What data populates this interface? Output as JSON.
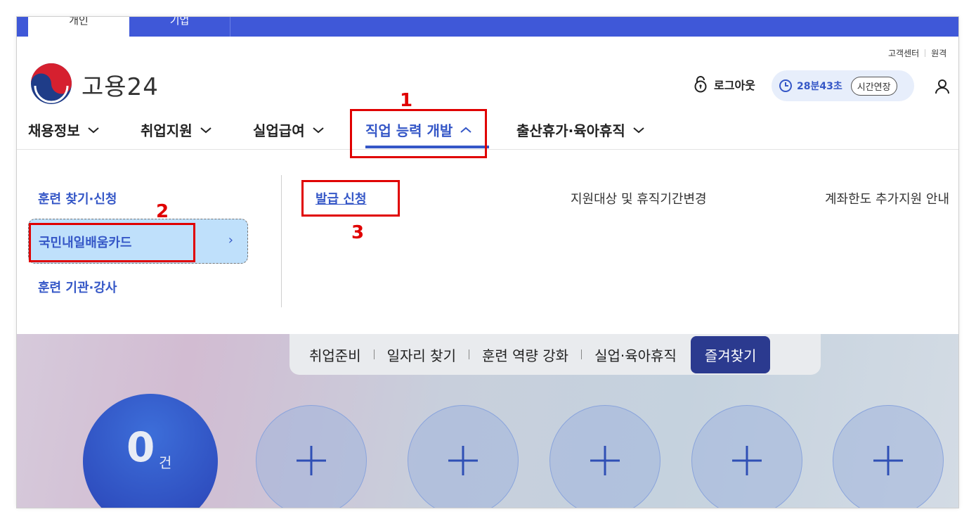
{
  "top_tabs": {
    "personal": "개인",
    "company": "기업"
  },
  "util_links": {
    "customer_center": "고객센터",
    "remote": "원격"
  },
  "brand": {
    "name": "고용24"
  },
  "header": {
    "logout": "로그아웃",
    "timer": "28분43초",
    "extend": "시간연장"
  },
  "gnb": {
    "items": [
      "채용정보",
      "취업지원",
      "실업급여",
      "직업 능력 개발",
      "출산휴가·육아휴직"
    ],
    "active": "직업 능력 개발"
  },
  "annotations": [
    "1",
    "2",
    "3"
  ],
  "mega_menu": {
    "lnb": [
      "훈련 찾기·신청",
      "국민내일배움카드",
      "훈련 기관·강사"
    ],
    "sub": [
      "발급 신청",
      "지원대상 및 휴직기간변경",
      "계좌한도 추가지원 안내"
    ]
  },
  "quick_menu": {
    "items": [
      "취업준비",
      "일자리 찾기",
      "훈련 역량 강화",
      "실업·육아휴직"
    ],
    "favorites": "즐겨찾기"
  },
  "count": {
    "value": "0",
    "unit": "건"
  },
  "colors": {
    "primary": "#3f58d8",
    "accent": "#3557c7",
    "annotation": "#e00000",
    "favorite": "#2b3a8f"
  }
}
